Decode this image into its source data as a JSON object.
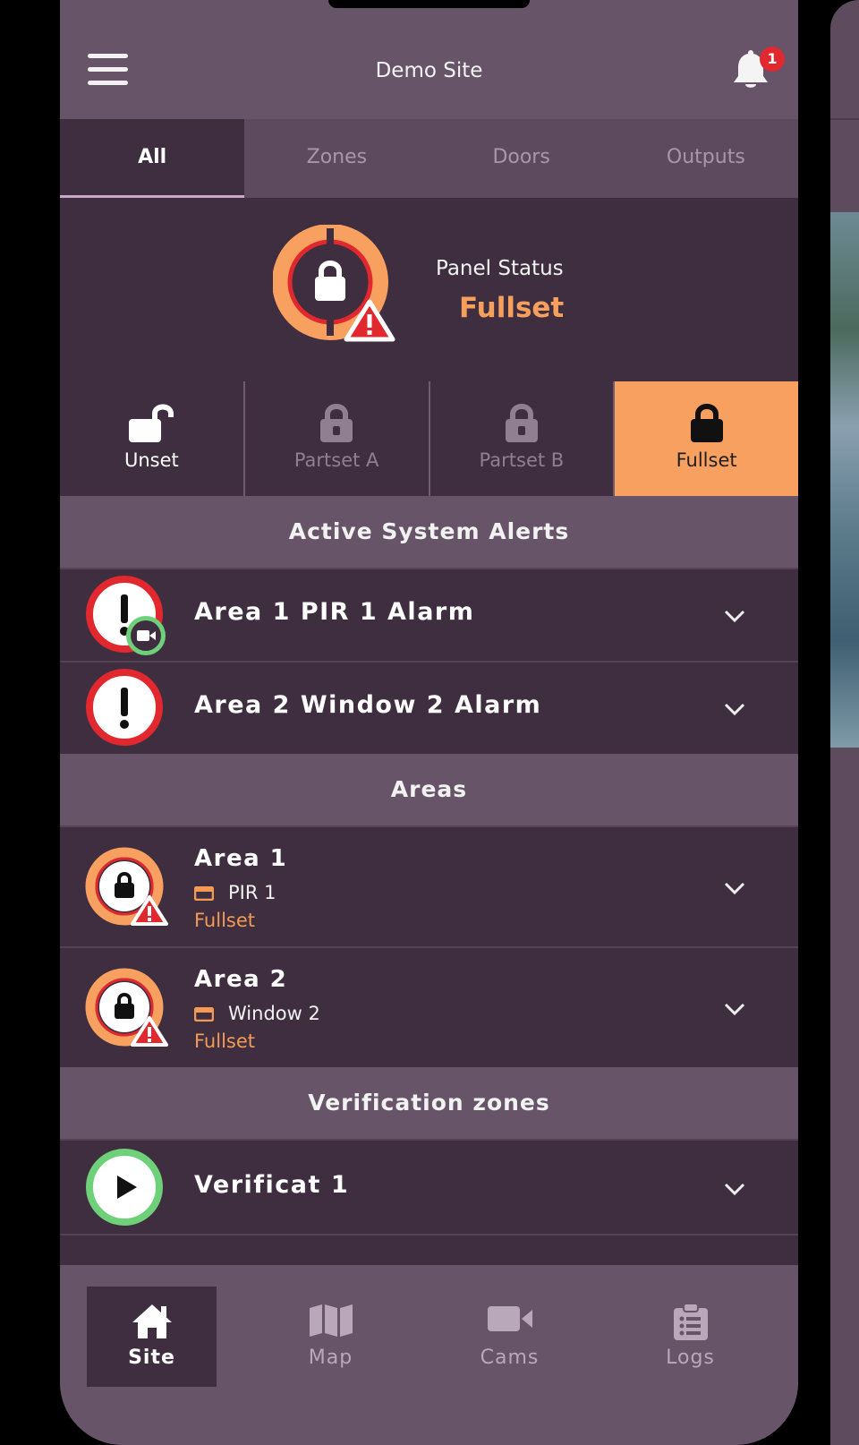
{
  "header": {
    "title": "Demo Site",
    "notification_count": "1"
  },
  "tabs": [
    {
      "label": "All",
      "active": true
    },
    {
      "label": "Zones",
      "active": false
    },
    {
      "label": "Doors",
      "active": false
    },
    {
      "label": "Outputs",
      "active": false
    }
  ],
  "panel": {
    "status_label": "Panel Status",
    "status_value": "Fullset"
  },
  "modes": [
    {
      "label": "Unset",
      "active": false
    },
    {
      "label": "Partset A",
      "active": false
    },
    {
      "label": "Partset B",
      "active": false
    },
    {
      "label": "Fullset",
      "active": true
    }
  ],
  "sections": {
    "alerts": "Active System Alerts",
    "areas": "Areas",
    "verification": "Verification zones"
  },
  "alerts": [
    {
      "name": "Area 1 PIR 1 Alarm",
      "has_camera": true
    },
    {
      "name": "Area 2 Window 2 Alarm",
      "has_camera": false
    }
  ],
  "areas": [
    {
      "name": "Area 1",
      "zone": "PIR 1",
      "state": "Fullset"
    },
    {
      "name": "Area 2",
      "zone": "Window 2",
      "state": "Fullset"
    }
  ],
  "verification": [
    {
      "name": "Verificat 1"
    }
  ],
  "nav": [
    {
      "label": "Site",
      "icon": "home-icon",
      "active": true
    },
    {
      "label": "Map",
      "icon": "map-icon",
      "active": false
    },
    {
      "label": "Cams",
      "icon": "camera-icon",
      "active": false
    },
    {
      "label": "Logs",
      "icon": "clipboard-icon",
      "active": false
    }
  ],
  "colors": {
    "background": "#675468",
    "surface": "#3e2e3f",
    "accent_orange": "#f8a05f",
    "alert_red": "#e0282e",
    "ok_green": "#6fd07a"
  }
}
